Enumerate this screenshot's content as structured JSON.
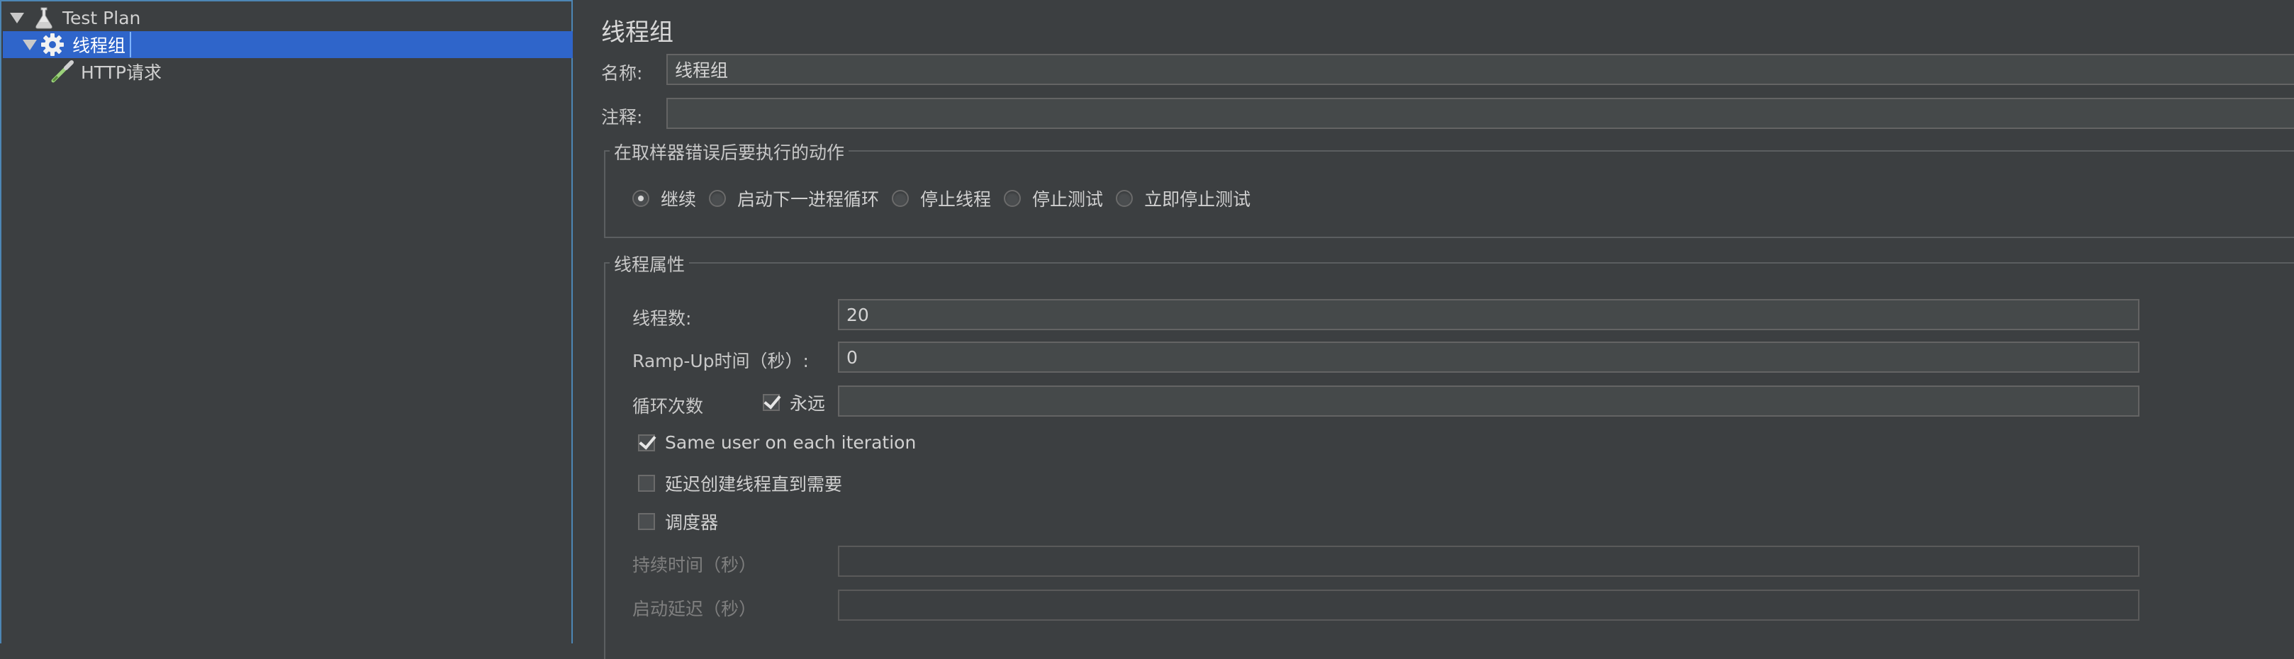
{
  "tree": {
    "test_plan": "Test Plan",
    "thread_group": "线程组",
    "http_request": "HTTP请求"
  },
  "form": {
    "title": "线程组",
    "name_label": "名称:",
    "name_value": "线程组",
    "comment_label": "注释:",
    "comment_value": "",
    "error_action": {
      "title": "在取样器错误后要执行的动作",
      "options": [
        "继续",
        "启动下一进程循环",
        "停止线程",
        "停止测试",
        "立即停止测试"
      ],
      "selected": "继续"
    },
    "thread_props": {
      "title": "线程属性",
      "threads_label": "线程数:",
      "threads_value": "20",
      "rampup_label": "Ramp-Up时间（秒）:",
      "rampup_value": "0",
      "loop_label": "循环次数",
      "forever_label": "永远",
      "forever_checked": true,
      "loop_value": "",
      "same_user_label": "Same user on each iteration",
      "same_user_checked": true,
      "delay_label": "延迟创建线程直到需要",
      "delay_checked": false,
      "scheduler_label": "调度器",
      "scheduler_checked": false,
      "duration_label": "持续时间（秒）",
      "duration_value": "",
      "startup_delay_label": "启动延迟（秒）",
      "startup_delay_value": ""
    }
  },
  "colors": {
    "selection": "#2f65ca",
    "background": "#3c3f41",
    "input_bg": "#45494a"
  }
}
